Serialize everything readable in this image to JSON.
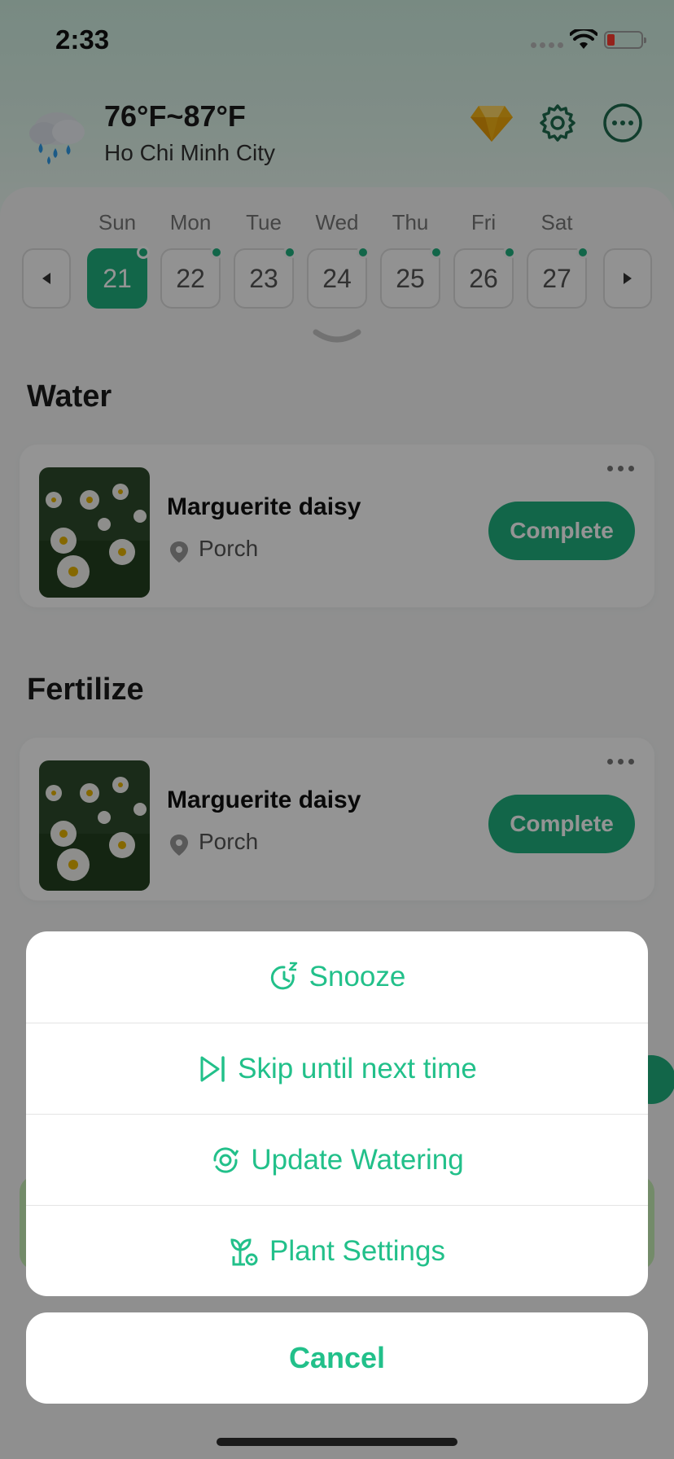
{
  "status_bar": {
    "time": "2:33"
  },
  "weather": {
    "temperature": "76°F~87°F",
    "city": "Ho Chi Minh City"
  },
  "calendar": {
    "days": [
      {
        "name": "Sun",
        "date": "21",
        "selected": true
      },
      {
        "name": "Mon",
        "date": "22",
        "selected": false
      },
      {
        "name": "Tue",
        "date": "23",
        "selected": false
      },
      {
        "name": "Wed",
        "date": "24",
        "selected": false
      },
      {
        "name": "Thu",
        "date": "25",
        "selected": false
      },
      {
        "name": "Fri",
        "date": "26",
        "selected": false
      },
      {
        "name": "Sat",
        "date": "27",
        "selected": false
      }
    ]
  },
  "sections": [
    {
      "title": "Water",
      "plant_name": "Marguerite daisy",
      "location": "Porch",
      "action_label": "Complete"
    },
    {
      "title": "Fertilize",
      "plant_name": "Marguerite daisy",
      "location": "Porch",
      "action_label": "Complete"
    }
  ],
  "action_sheet": {
    "items": [
      {
        "label": "Snooze",
        "icon": "snooze-icon"
      },
      {
        "label": "Skip until next time",
        "icon": "skip-icon"
      },
      {
        "label": "Update Watering",
        "icon": "update-watering-icon"
      },
      {
        "label": "Plant Settings",
        "icon": "plant-settings-icon"
      }
    ],
    "cancel_label": "Cancel"
  },
  "colors": {
    "accent": "#1fb07f",
    "action_text": "#22c08a",
    "header_bg": "#cfeee1"
  }
}
